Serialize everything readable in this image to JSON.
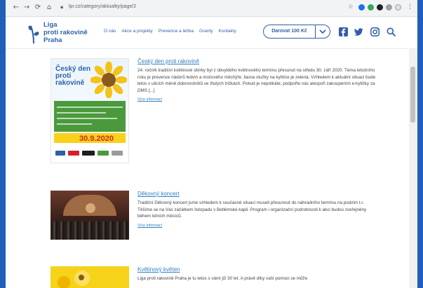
{
  "browser": {
    "url": "lpr.cz/category/aktuality/page/2"
  },
  "site": {
    "logo_lines": [
      "Liga",
      "proti rakovině",
      "Praha"
    ],
    "menu": [
      "O nás",
      "Akce a projekty",
      "Prevence a léčba",
      "Granty",
      "Kontakty"
    ],
    "donate_label": "Darovat 100 Kč",
    "brand_color": "#2f5fa7",
    "social_icons": [
      "facebook-icon",
      "twitter-icon",
      "instagram-icon",
      "search-icon"
    ]
  },
  "articles": [
    {
      "title": "Český den proti rakovině",
      "excerpt": "24. ročník tradiční květinové sbírky byl z obvyklého květnového termínu přesunut na středu 30. září 2020. Téma letošního roku je prevence nádorů ledvin a močového měchýře, barva stužky na kytičce je zelená. Vzhledem k aktuální situaci bude letos v ulicích méně dobrovolníků ve žlutých tričkách. Pokud je nepotkáte, podpořte nás alespoň zakoupením e-kytičky za DMS [...]",
      "more": "Více informací",
      "poster": {
        "title_lines": [
          "Český den",
          "proti",
          "rakovině"
        ],
        "date": "30.9.2020"
      }
    },
    {
      "title": "Děkovný koncert",
      "excerpt": "Tradiční Děkovný koncert jsme vzhledem k současné situaci museli přesunout do náhradního termínu na podzim t.r. Těšíme se na Vás začátkem listopadu v Betlémské kapli. Program i organizační podrobnosti k akci budou zveřejněny během letních měsíců.",
      "more": "Více informací"
    },
    {
      "title": "Květinový květen",
      "excerpt": "Liga proti rakovině Praha je tu letos s vámi již 30 let. A právě díky vaší pomoci se může"
    }
  ]
}
